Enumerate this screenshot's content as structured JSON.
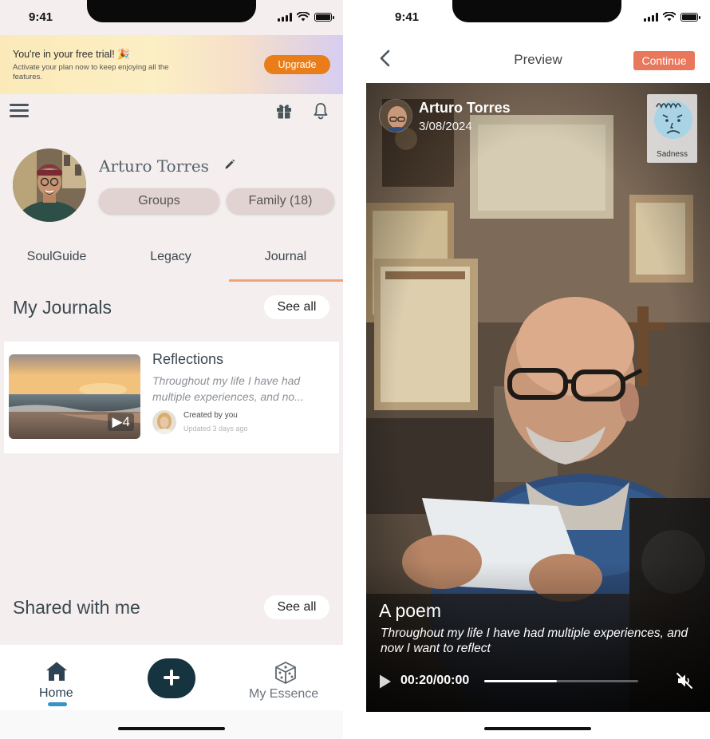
{
  "left": {
    "status_time": "9:41",
    "banner": {
      "title": "You're in your free trial! 🎉",
      "subtitle": "Activate your plan now to keep enjoying all the features.",
      "upgrade_label": "Upgrade"
    },
    "profile": {
      "name": "Arturo Torres",
      "groups_label": "Groups",
      "family_label": "Family (18)"
    },
    "tabs": [
      {
        "label": "SoulGuide"
      },
      {
        "label": "Legacy"
      },
      {
        "label": "Journal"
      }
    ],
    "active_tab": "Journal",
    "my_journals": {
      "title": "My Journals",
      "see_all": "See all",
      "items": [
        {
          "title": "Reflections",
          "description": "Throughout my life I have had multiple experiences, and no...",
          "count": "4",
          "created_by": "Created by you",
          "updated": "Updated 3 days ago"
        }
      ]
    },
    "shared": {
      "title": "Shared with me",
      "see_all": "See all"
    },
    "nav": {
      "home_label": "Home",
      "fab_label": "+",
      "essence_label": "My Essence"
    }
  },
  "right": {
    "status_time": "9:41",
    "header": {
      "title": "Preview",
      "continue_label": "Continue"
    },
    "video": {
      "author": "Arturo Torres",
      "date": "3/08/2024",
      "emotion": "Sadness",
      "title": "A poem",
      "text": "Throughout my life I have had multiple experiences, and now I want to reflect",
      "timecode": "00:20/00:00",
      "progress": 0.47,
      "muted": true
    }
  },
  "colors": {
    "accent_orange": "#e87d1a",
    "continue_coral": "#e9775b",
    "tab_underline": "#f0a473",
    "fab_dark": "#15343f",
    "home_indicator_blue": "#3894c4"
  }
}
